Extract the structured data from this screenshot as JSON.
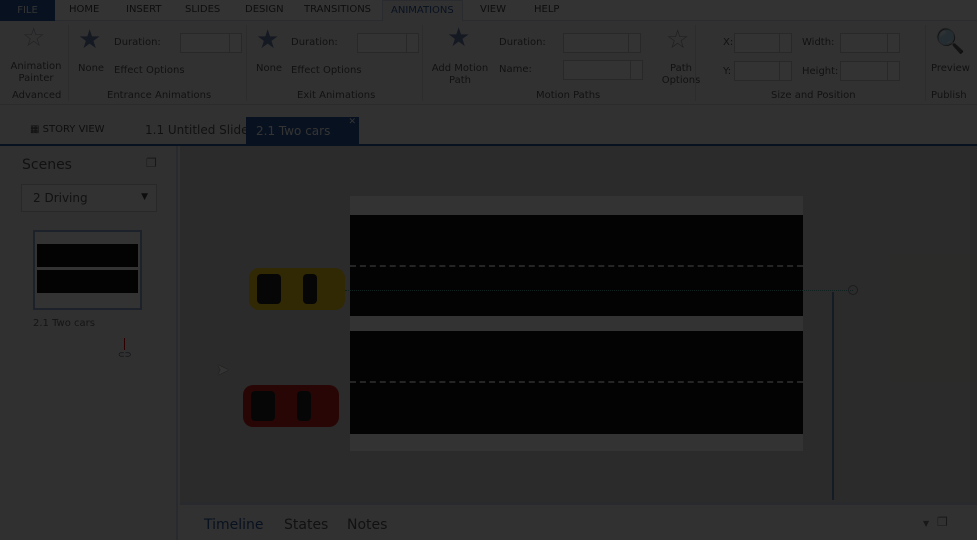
{
  "menu": {
    "file": "FILE",
    "tabs": [
      "HOME",
      "INSERT",
      "SLIDES",
      "DESIGN",
      "TRANSITIONS",
      "ANIMATIONS",
      "VIEW",
      "HELP"
    ]
  },
  "ribbon": {
    "advanced": {
      "button": "Animation Painter",
      "group": "Advanced"
    },
    "entrance": {
      "none": "None",
      "duration": "Duration:",
      "effect": "Effect Options",
      "group": "Entrance Animations"
    },
    "exit": {
      "none": "None",
      "duration": "Duration:",
      "effect": "Effect Options",
      "group": "Exit Animations"
    },
    "motion": {
      "add": "Add Motion Path",
      "duration": "Duration:",
      "name": "Name:",
      "path_options": "Path Options",
      "group": "Motion Paths"
    },
    "size": {
      "x": "X:",
      "y": "Y:",
      "width": "Width:",
      "height": "Height:",
      "group": "Size and Position"
    },
    "publish": {
      "preview": "Preview",
      "group": "Publish"
    }
  },
  "doc_tabs": {
    "story_view": "STORY VIEW",
    "tab1": "1.1 Untitled Slide",
    "tab2": "2.1 Two cars"
  },
  "scenes": {
    "title": "Scenes",
    "selected": "2 Driving",
    "slide_label": "2.1 Two cars"
  },
  "bottom": {
    "tabs": [
      "Timeline",
      "States",
      "Notes"
    ]
  }
}
